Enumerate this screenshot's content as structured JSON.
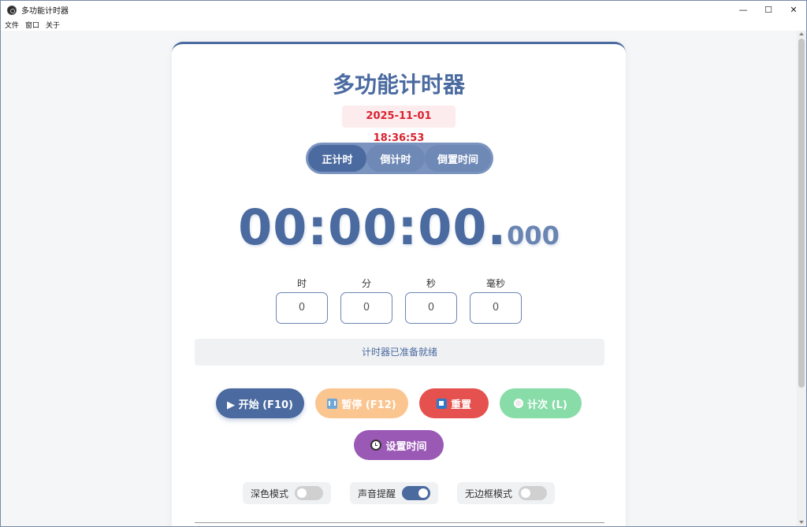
{
  "window": {
    "title": "多功能计时器",
    "controls": {
      "minimize": "—",
      "maximize": "☐",
      "close": "✕"
    }
  },
  "menu": [
    "文件",
    "窗口",
    "关于"
  ],
  "app": {
    "title": "多功能计时器",
    "datetime": "2025-11-01 18:36:53",
    "mode_tabs": [
      "正计时",
      "倒计时",
      "倒置时间"
    ],
    "timer_main": "00:00:00.",
    "timer_ms": "000",
    "inputs": [
      {
        "label": "时",
        "value": "0"
      },
      {
        "label": "分",
        "value": "0"
      },
      {
        "label": "秒",
        "value": "0"
      },
      {
        "label": "毫秒",
        "value": "0"
      }
    ],
    "status": "计时器已准备就绪",
    "buttons": {
      "start": "▶ 开始 (F10)",
      "pause": "暂停 (F12)",
      "reset": "重置",
      "lap": "计次 (L)",
      "set_time": "设置时间"
    },
    "toggles": [
      {
        "label": "深色模式",
        "on": false
      },
      {
        "label": "声音提醒",
        "on": true
      },
      {
        "label": "无边框模式",
        "on": false
      }
    ]
  },
  "colors": {
    "primary": "#4a6aa0",
    "accent_red": "#d9232f",
    "pause": "#fbc590",
    "reset": "#e5514e",
    "lap": "#88dca8",
    "set_time": "#9b59b6"
  }
}
